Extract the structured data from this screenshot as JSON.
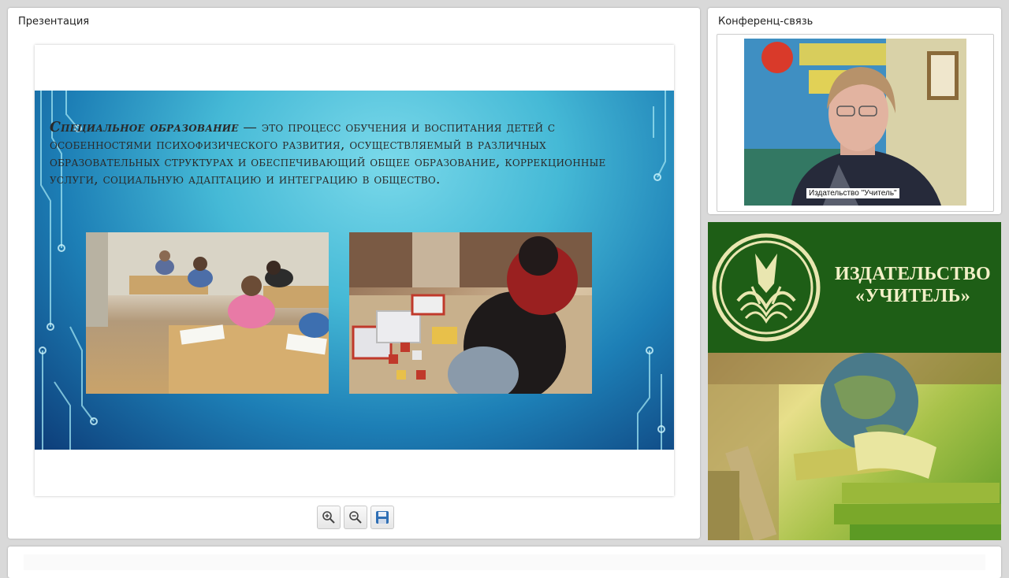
{
  "presentation": {
    "title": "Презентация",
    "slide": {
      "term": "Специальное образование",
      "definition": " — это процесс обучения и воспитания детей с особенностями психофизического развития, осуществляемый в различных образовательных структурах и обеспечивающий общее образование, коррекционные услуги, социальную адаптацию и интеграцию в общество."
    },
    "toolbar": {
      "zoom_in_icon": "zoom-in-icon",
      "zoom_out_icon": "zoom-out-icon",
      "save_icon": "save-icon"
    }
  },
  "conference": {
    "title": "Конференц-связь",
    "participant_label": "Издательство \"Учитель\""
  },
  "banner": {
    "line1": "ИЗДАТЕЛЬСТВО",
    "line2": "«УЧИТЕЛЬ»"
  },
  "colors": {
    "banner_green": "#1e5e16",
    "banner_text": "#f3f0c8",
    "slide_blue": "#1d7fb6"
  }
}
